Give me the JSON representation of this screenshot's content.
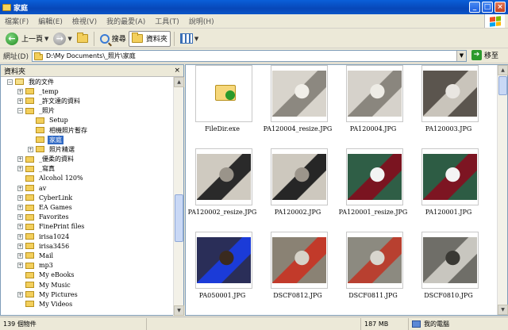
{
  "window": {
    "title": "家庭"
  },
  "titlebar_buttons": [
    "_",
    "□",
    "×"
  ],
  "menu": [
    "檔案(F)",
    "編輯(E)",
    "檢視(V)",
    "我的最愛(A)",
    "工具(T)",
    "說明(H)"
  ],
  "toolbar": {
    "back_label": "上一頁",
    "search_label": "搜尋",
    "folders_label": "資料夾"
  },
  "address": {
    "label": "網址(D)",
    "value": "D:\\My Documents\\_照片\\家庭",
    "go_label": "移至"
  },
  "tree": {
    "header": "資料夾",
    "close": "×",
    "items": [
      {
        "label": "我的文件",
        "indent": 0,
        "expander": "−",
        "selected": false
      },
      {
        "label": "_temp",
        "indent": 1,
        "expander": "+",
        "selected": false
      },
      {
        "label": "_許文達的資料",
        "indent": 1,
        "expander": "+",
        "selected": false
      },
      {
        "label": "_照片",
        "indent": 1,
        "expander": "−",
        "selected": false
      },
      {
        "label": "Setup",
        "indent": 2,
        "expander": "",
        "selected": false
      },
      {
        "label": "相機照片暫存",
        "indent": 2,
        "expander": "",
        "selected": false
      },
      {
        "label": "家庭",
        "indent": 2,
        "expander": "",
        "selected": true
      },
      {
        "label": "照片精選",
        "indent": 2,
        "expander": "+",
        "selected": false
      },
      {
        "label": "_優柔的資料",
        "indent": 1,
        "expander": "+",
        "selected": false
      },
      {
        "label": "_寫真",
        "indent": 1,
        "expander": "+",
        "selected": false
      },
      {
        "label": "Alcohol 120%",
        "indent": 1,
        "expander": "",
        "selected": false
      },
      {
        "label": "av",
        "indent": 1,
        "expander": "+",
        "selected": false
      },
      {
        "label": "CyberLink",
        "indent": 1,
        "expander": "+",
        "selected": false
      },
      {
        "label": "EA Games",
        "indent": 1,
        "expander": "+",
        "selected": false
      },
      {
        "label": "Favorites",
        "indent": 1,
        "expander": "+",
        "selected": false
      },
      {
        "label": "FinePrint files",
        "indent": 1,
        "expander": "+",
        "selected": false
      },
      {
        "label": "irisa1024",
        "indent": 1,
        "expander": "+",
        "selected": false
      },
      {
        "label": "irisa3456",
        "indent": 1,
        "expander": "+",
        "selected": false
      },
      {
        "label": "Mail",
        "indent": 1,
        "expander": "+",
        "selected": false
      },
      {
        "label": "mp3",
        "indent": 1,
        "expander": "+",
        "selected": false
      },
      {
        "label": "My eBooks",
        "indent": 1,
        "expander": "",
        "selected": false
      },
      {
        "label": "My Music",
        "indent": 1,
        "expander": "",
        "selected": false
      },
      {
        "label": "My Pictures",
        "indent": 1,
        "expander": "+",
        "selected": false
      },
      {
        "label": "My Videos",
        "indent": 1,
        "expander": "",
        "selected": false
      }
    ]
  },
  "files": [
    {
      "name": "FileDir.exe",
      "kind": "program",
      "colors": [
        "#f6d77a",
        "#2b9a2b"
      ]
    },
    {
      "name": "PA120004_resize.JPG",
      "kind": "photo",
      "colors": [
        "#d8d4cc",
        "#8c8880",
        "#f1efe9"
      ]
    },
    {
      "name": "PA120004.JPG",
      "kind": "photo",
      "colors": [
        "#d6d2cb",
        "#8a867e",
        "#eeece6"
      ]
    },
    {
      "name": "PA120003.JPG",
      "kind": "photo",
      "colors": [
        "#5b554e",
        "#c9c4bb",
        "#e9e6e1"
      ]
    },
    {
      "name": "PA120002_resize.JPG",
      "kind": "photo",
      "colors": [
        "#cfcac0",
        "#2a2a2a",
        "#9a948a"
      ]
    },
    {
      "name": "PA120002.JPG",
      "kind": "photo",
      "colors": [
        "#cdc8be",
        "#262626",
        "#9c958b"
      ]
    },
    {
      "name": "PA120001_resize.JPG",
      "kind": "photo",
      "colors": [
        "#2f5e46",
        "#7a1420",
        "#f3f3f3"
      ]
    },
    {
      "name": "PA120001.JPG",
      "kind": "photo",
      "colors": [
        "#2d5c44",
        "#7d1522",
        "#f4f4f4"
      ]
    },
    {
      "name": "PA050001.JPG",
      "kind": "photo",
      "colors": [
        "#2a2e58",
        "#1b3bd8",
        "#3a2a1f"
      ]
    },
    {
      "name": "DSCF0812.JPG",
      "kind": "photo",
      "colors": [
        "#8a8274",
        "#c23a2a",
        "#d6d2c8"
      ]
    },
    {
      "name": "DSCF0811.JPG",
      "kind": "photo",
      "colors": [
        "#8c8a80",
        "#b84030",
        "#d8d6ce"
      ]
    },
    {
      "name": "DSCF0810.JPG",
      "kind": "photo",
      "colors": [
        "#6f6e68",
        "#c8c6bf",
        "#3a3934"
      ]
    }
  ],
  "status": {
    "count": "139 個物件",
    "size": "187 MB",
    "location": "我的電腦"
  }
}
